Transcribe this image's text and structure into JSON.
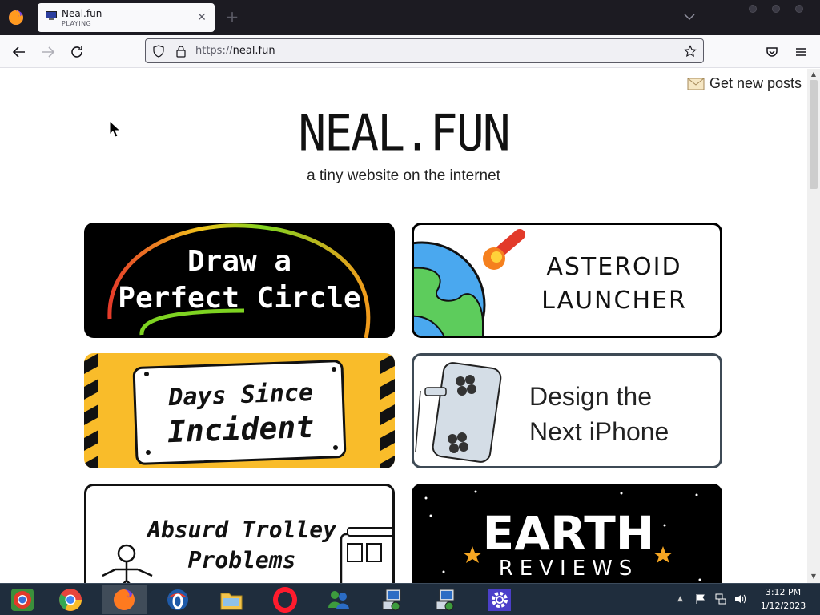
{
  "browser": {
    "tab": {
      "title": "Neal.fun",
      "status": "PLAYING"
    },
    "url": {
      "scheme": "https://",
      "host": "neal.fun"
    }
  },
  "page": {
    "get_posts": "Get new posts",
    "title": "NEAL.FUN",
    "subtitle": "a tiny website on the internet",
    "cards": [
      {
        "line1": "Draw a",
        "line2": "Perfect Circle"
      },
      {
        "line1": "ASTEROID",
        "line2": "LAUNCHER"
      },
      {
        "line1": "Days Since",
        "line2": "Incident"
      },
      {
        "line1": "Design the",
        "line2": "Next iPhone"
      },
      {
        "line1": "Absurd Trolley",
        "line2": "Problems"
      },
      {
        "line1": "EARTH",
        "line2": "REVIEWS"
      }
    ]
  },
  "taskbar": {
    "apps": [
      "chrome-old-icon",
      "chrome-icon",
      "firefox-icon",
      "opera-o-icon",
      "file-explorer-icon",
      "opera-icon",
      "msn-messenger-icon",
      "network-computer-icon",
      "network-computer-icon",
      "settings-gear-icon"
    ],
    "time": "3:12 PM",
    "date": "1/12/2023"
  },
  "colors": {
    "tabstrip": "#1c1b22",
    "toolbar": "#f9f9fb",
    "taskbar": "#1f2d3d",
    "days_yellow": "#f9bc2a"
  }
}
